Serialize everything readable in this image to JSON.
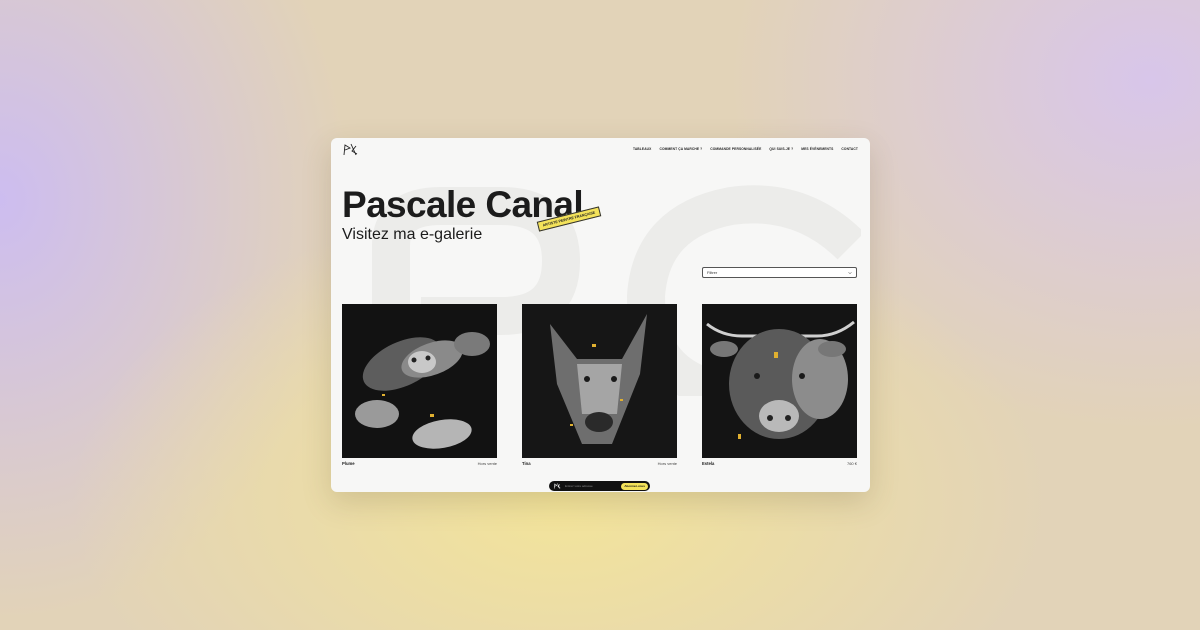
{
  "brand": {
    "logo": "PC-monogram-logo"
  },
  "nav": {
    "items": [
      {
        "label": "TABLEAUX"
      },
      {
        "label": "COMMENT ÇA MARCHE ?"
      },
      {
        "label": "COMMANDE PERSONNALISÉE"
      },
      {
        "label": "QUI SUIS-JE ?"
      },
      {
        "label": "MES ÉVÉNEMENTS"
      },
      {
        "label": "CONTACT"
      }
    ]
  },
  "hero": {
    "title": "Pascale Canal",
    "subtitle": "Visitez ma e-galerie",
    "tag": "ARTISTE PEINTRE FRANÇAISE"
  },
  "filter": {
    "label": "Filtrer",
    "icon": "chevron-down-icon"
  },
  "gallery": {
    "items": [
      {
        "name": "Plume",
        "price": "Hors vente"
      },
      {
        "name": "Tina",
        "price": "Hors vente"
      },
      {
        "name": "Estela",
        "price": "760 €"
      }
    ]
  },
  "bottom_bar": {
    "input_placeholder": "Entrez votre adresse",
    "button_label": "Abonnez-vous"
  },
  "colors": {
    "accent": "#f3e25a",
    "text": "#1c1c1c",
    "panel": "#f7f7f6"
  }
}
